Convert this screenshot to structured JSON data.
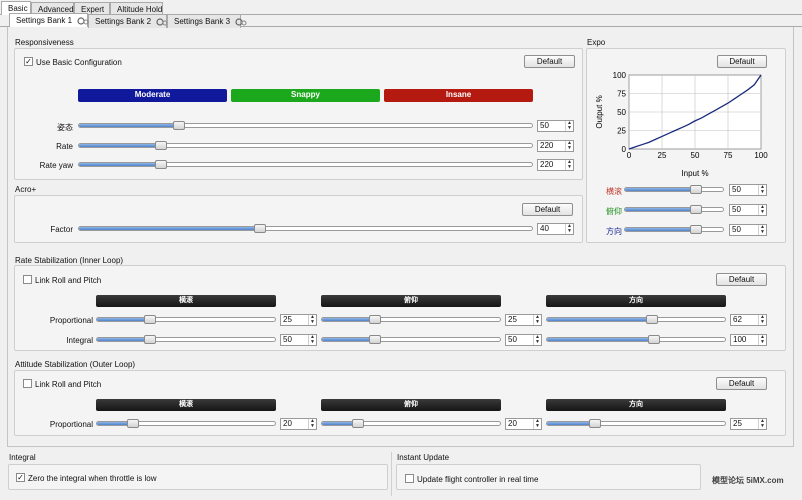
{
  "tabs": [
    "Basic",
    "Advanced",
    "Expert",
    "Altitude Hold"
  ],
  "bank_tabs": [
    "Settings Bank 1",
    "Settings Bank 2",
    "Settings Bank 3"
  ],
  "responsiveness": {
    "title": "Responsiveness",
    "use_basic_label": "Use Basic Configuration",
    "use_basic_checked": true,
    "default_label": "Default",
    "presets": [
      {
        "label": "Moderate",
        "color": "#10189b"
      },
      {
        "label": "Snappy",
        "color": "#1ca81c"
      },
      {
        "label": "Insane",
        "color": "#b51a10"
      }
    ],
    "rows": [
      {
        "label": "姿态",
        "value": "50",
        "fraction": 0.22
      },
      {
        "label": "Rate",
        "value": "220",
        "fraction": 0.18
      },
      {
        "label": "Rate yaw",
        "value": "220",
        "fraction": 0.18
      }
    ]
  },
  "expo": {
    "title": "Expo",
    "default_label": "Default",
    "rows": [
      {
        "label": "横滚",
        "value": "50",
        "fraction": 0.72,
        "color": "#c0392b"
      },
      {
        "label": "俯仰",
        "value": "50",
        "fraction": 0.72,
        "color": "#1a8f1a"
      },
      {
        "label": "方向",
        "value": "50",
        "fraction": 0.72,
        "color": "#1a2a8f"
      }
    ]
  },
  "acro": {
    "title": "Acro+",
    "default_label": "Default",
    "factor_label": "Factor",
    "factor_value": "40",
    "factor_fraction": 0.4
  },
  "rate_stab": {
    "title": "Rate Stabilization (Inner Loop)",
    "link_label": "Link Roll and Pitch",
    "link_checked": false,
    "default_label": "Default",
    "headers": [
      "横滚",
      "俯仰",
      "方向"
    ],
    "rows": [
      {
        "label": "Proportional",
        "values": [
          "25",
          "25",
          "62"
        ],
        "fractions": [
          0.3,
          0.3,
          0.59
        ]
      },
      {
        "label": "Integral",
        "values": [
          "50",
          "50",
          "100"
        ],
        "fractions": [
          0.3,
          0.3,
          0.6
        ]
      }
    ]
  },
  "att_stab": {
    "title": "Attitude Stabilization (Outer Loop)",
    "link_label": "Link Roll and Pitch",
    "link_checked": false,
    "default_label": "Default",
    "headers": [
      "横滚",
      "俯仰",
      "方向"
    ],
    "rows": [
      {
        "label": "Proportional",
        "values": [
          "20",
          "20",
          "25"
        ],
        "fractions": [
          0.2,
          0.2,
          0.27
        ]
      }
    ]
  },
  "integral": {
    "title": "Integral",
    "zero_label": "Zero the integral when throttle is low",
    "zero_checked": true
  },
  "instant_update": {
    "title": "Instant Update",
    "update_label": "Update flight controller in real time",
    "update_checked": false
  },
  "watermark": {
    "text": "模型论坛 5iMX.com"
  },
  "chart_data": {
    "type": "line",
    "xlabel": "Input %",
    "ylabel": "Output %",
    "xlim": [
      0,
      100
    ],
    "ylim": [
      0,
      100
    ],
    "xticks": [
      "0",
      "25",
      "50",
      "75",
      "100"
    ],
    "yticks": [
      "0",
      "25",
      "50",
      "75",
      "100"
    ],
    "grid": true,
    "x": [
      0,
      5,
      10,
      15,
      20,
      25,
      30,
      35,
      40,
      45,
      50,
      55,
      60,
      65,
      70,
      75,
      80,
      85,
      90,
      95,
      100
    ],
    "series": [
      {
        "color": "#1a2a7a",
        "values": [
          0,
          3,
          6,
          9,
          13,
          17,
          21,
          25,
          29,
          33,
          38,
          42,
          47,
          52,
          57,
          62,
          68,
          74,
          80,
          87,
          100
        ]
      }
    ]
  }
}
